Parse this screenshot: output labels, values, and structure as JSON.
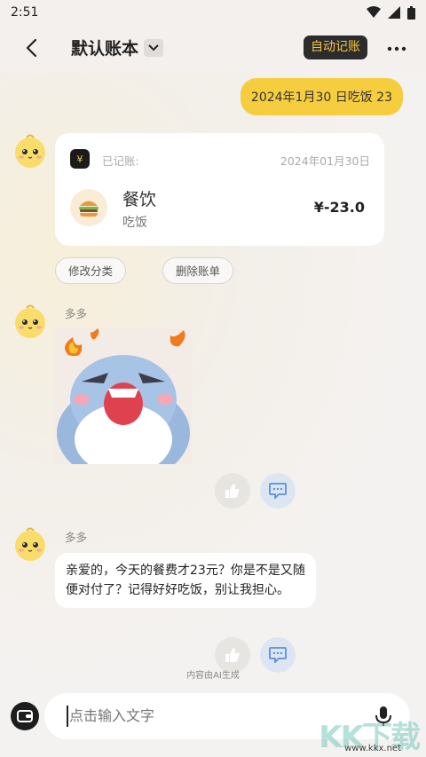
{
  "status_bar": {
    "time": "2:51"
  },
  "app_bar": {
    "title": "默认账本",
    "auto_record_label": "自动记账"
  },
  "chat": {
    "user_message": "2024年1月30 日吃饭 23",
    "record_card": {
      "recorded_label": "已记账:",
      "date": "2024年01月30日",
      "category": "餐饮",
      "note": "吃饭",
      "amount": "¥-23.0",
      "yen_symbol": "¥"
    },
    "record_actions": {
      "edit_label": "修改分类",
      "delete_label": "删除账单"
    },
    "bot_name": "多多",
    "bot_reply": "亲爱的，今天的餐费才23元？你是不是又随便对付了？记得好好吃饭，别让我担心。",
    "ai_note": "内容由AI生成"
  },
  "input": {
    "placeholder": "点击输入文字"
  },
  "watermark": {
    "brand": "KK下载",
    "url": "www.kkx.net"
  },
  "colors": {
    "accent_yellow": "#f6cd3e",
    "dark": "#2c2c2c",
    "auto_text": "#f4c544"
  }
}
